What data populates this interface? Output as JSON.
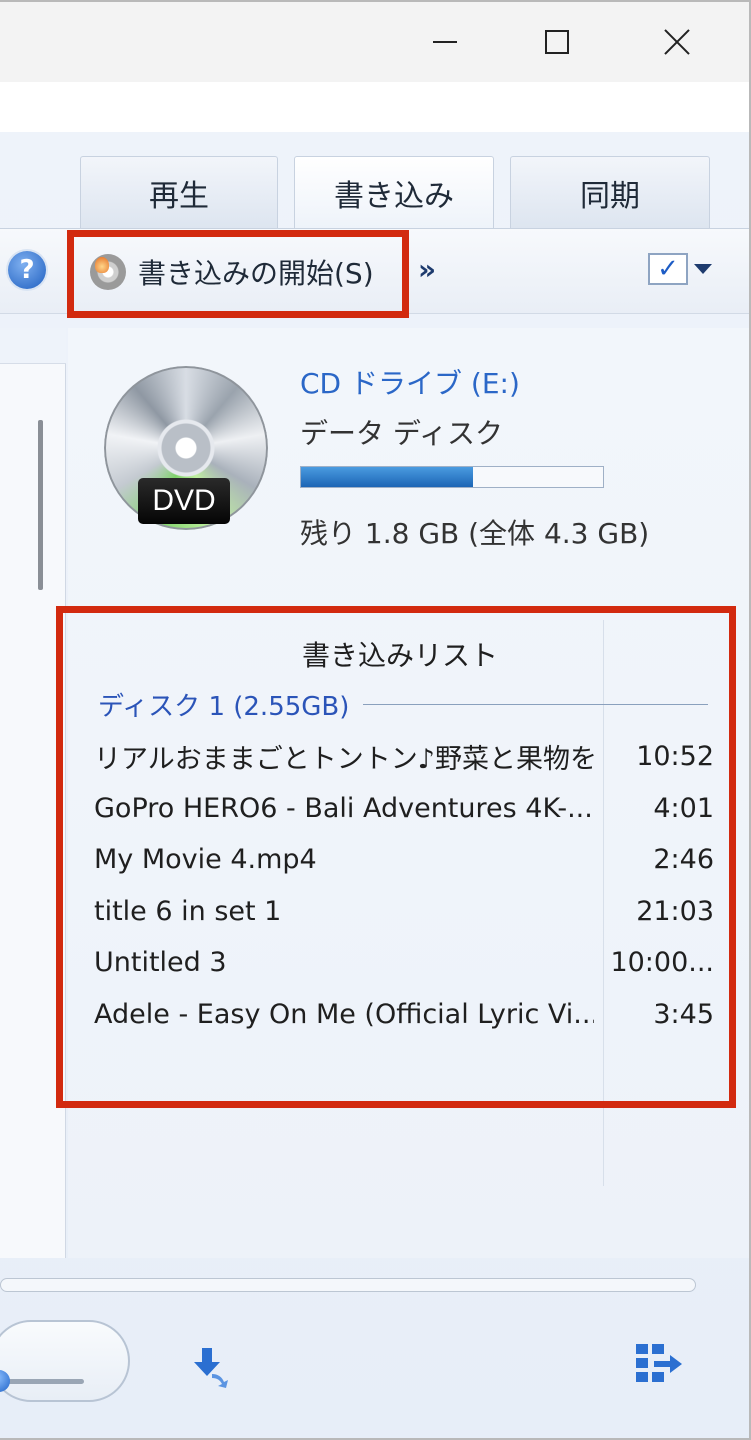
{
  "window": {
    "minimize_glyph": "",
    "maximize_glyph": "",
    "close_glyph": ""
  },
  "tabs": [
    {
      "label": "再生"
    },
    {
      "label": "書き込み"
    },
    {
      "label": "同期"
    }
  ],
  "toolbar": {
    "help_glyph": "?",
    "start_burn_label": "書き込みの開始(S)",
    "more_glyph": "»",
    "options_check_glyph": "✓"
  },
  "drive": {
    "name": "CD ドライブ (E:)",
    "disc_type": "データ ディスク",
    "badge": "DVD",
    "used_fraction": 0.57,
    "remaining_text": "残り 1.8 GB (全体 4.3 GB)"
  },
  "burn_list": {
    "title": "書き込みリスト",
    "disk_header": "ディスク 1 (2.55GB)",
    "items": [
      {
        "title": "リアルおままごとトントン♪野菜と果物を...",
        "duration": "10:52"
      },
      {
        "title": "GoPro HERO6 - Bali Adventures 4K-...",
        "duration": "4:01"
      },
      {
        "title": "My Movie 4.mp4",
        "duration": "2:46"
      },
      {
        "title": "title 6 in set 1",
        "duration": "21:03"
      },
      {
        "title": "Untitled 3",
        "duration": "10:00..."
      },
      {
        "title": "Adele - Easy On Me (Official Lyric Vi...",
        "duration": "3:45"
      }
    ]
  },
  "icons": {
    "help": "help-icon",
    "burn": "burn-disc-icon",
    "switch_view": "switch-to-now-playing-icon",
    "layout": "switch-layout-icon"
  },
  "colors": {
    "highlight": "#d22a0f",
    "accent": "#2b67c7"
  }
}
